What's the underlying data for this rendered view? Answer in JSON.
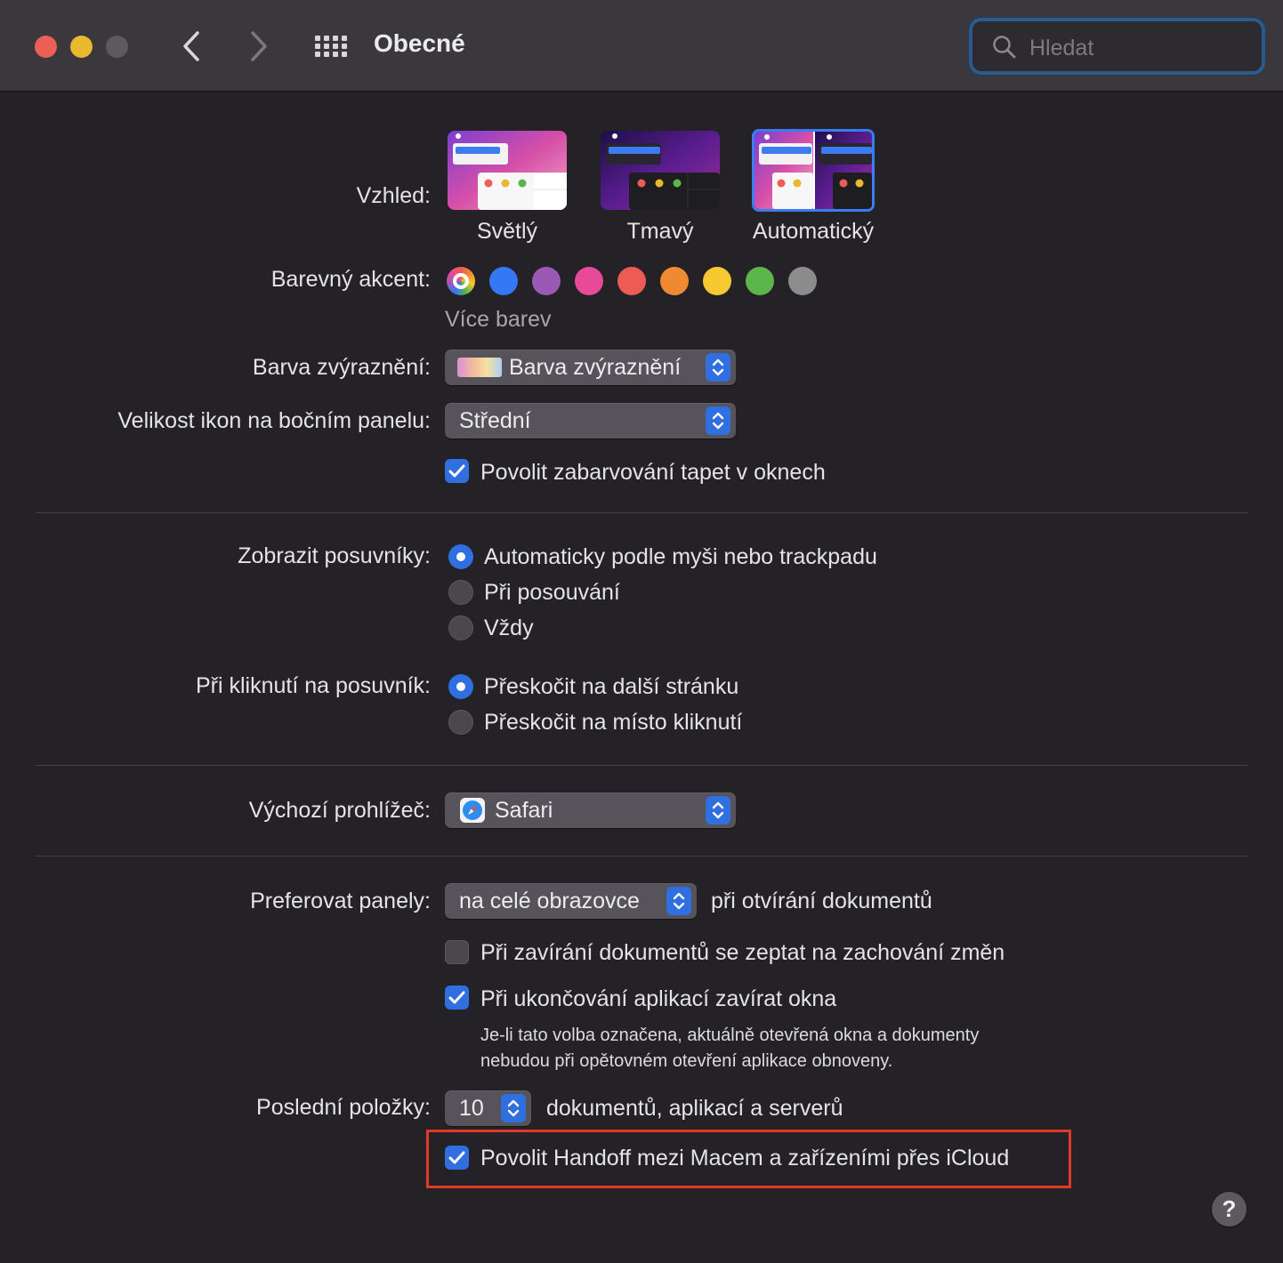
{
  "window": {
    "title": "Obecné"
  },
  "search": {
    "placeholder": "Hledat"
  },
  "appearance": {
    "label": "Vzhled:",
    "options": [
      {
        "label": "Světlý",
        "selected": false
      },
      {
        "label": "Tmavý",
        "selected": false
      },
      {
        "label": "Automatický",
        "selected": true
      }
    ]
  },
  "accent": {
    "label": "Barevný akcent:",
    "more_colors": "Více barev",
    "colors": [
      "multicolor",
      "#3478f6",
      "#9b59b6",
      "#e84a9a",
      "#ec5b54",
      "#ef8a32",
      "#f6c931",
      "#5bb54a",
      "#8c8c8c"
    ]
  },
  "highlight_color": {
    "label": "Barva zvýraznění:",
    "value": "Barva zvýraznění"
  },
  "sidebar_icon_size": {
    "label": "Velikost ikon na bočním panelu:",
    "value": "Střední"
  },
  "wallpaper_tinting": {
    "label": "Povolit zabarvování tapet v oknech",
    "checked": true
  },
  "show_scrollbars": {
    "label": "Zobrazit posuvníky:",
    "options": [
      {
        "label": "Automaticky podle myši nebo trackpadu",
        "selected": true
      },
      {
        "label": "Při posouvání",
        "selected": false
      },
      {
        "label": "Vždy",
        "selected": false
      }
    ]
  },
  "click_scrollbar": {
    "label": "Při kliknutí na posuvník:",
    "options": [
      {
        "label": "Přeskočit na další stránku",
        "selected": true
      },
      {
        "label": "Přeskočit na místo kliknutí",
        "selected": false
      }
    ]
  },
  "default_browser": {
    "label": "Výchozí prohlížeč:",
    "value": "Safari"
  },
  "prefer_tabs": {
    "label": "Preferovat panely:",
    "value": "na celé obrazovce",
    "suffix": "při otvírání dokumentů"
  },
  "ask_keep_changes": {
    "label": "Při zavírání dokumentů se zeptat na zachování změn",
    "checked": false
  },
  "close_windows": {
    "label": "Při ukončování aplikací zavírat okna",
    "checked": true,
    "note_line1": "Je-li tato volba označena, aktuálně otevřená okna a dokumenty",
    "note_line2": "nebudou při opětovném otevření aplikace obnoveny."
  },
  "recent_items": {
    "label": "Poslední položky:",
    "value": "10",
    "suffix": "dokumentů, aplikací a serverů"
  },
  "handoff": {
    "label": "Povolit Handoff mezi Macem a zařízeními přes iCloud",
    "checked": true
  },
  "help": {
    "label": "?"
  }
}
